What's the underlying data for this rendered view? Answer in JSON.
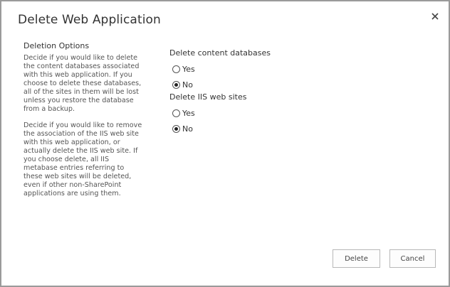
{
  "dialog": {
    "title": "Delete Web Application",
    "close_icon": "close-icon"
  },
  "left": {
    "heading": "Deletion Options",
    "paragraph1": "Decide if you would like to delete\nthe content databases associated\nwith this web application.  If you\nchoose to delete these databases,\nall of the sites in them will be lost\nunless you restore the database\nfrom a backup.",
    "paragraph2": "Decide if you would like to remove\nthe association of the IIS web site\nwith this web application, or\nactually delete the IIS web site.  If\nyou choose delete, all IIS\nmetabase entries referring to\nthese web sites will be deleted,\neven if other non-SharePoint\napplications are using them."
  },
  "content_databases": {
    "label": "Delete content databases",
    "options": [
      {
        "label": "Yes",
        "checked": false
      },
      {
        "label": "No",
        "checked": true
      }
    ]
  },
  "iis_sites": {
    "label": "Delete IIS web sites",
    "options": [
      {
        "label": "Yes",
        "checked": false
      },
      {
        "label": "No",
        "checked": true
      }
    ]
  },
  "buttons": {
    "delete": "Delete",
    "cancel": "Cancel"
  }
}
